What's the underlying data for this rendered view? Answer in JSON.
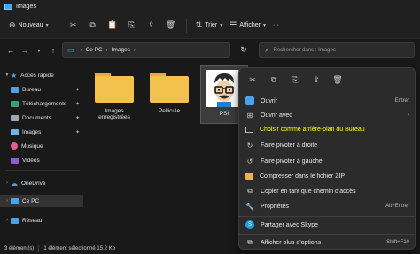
{
  "window": {
    "title": "Images"
  },
  "toolbar": {
    "new_label": "Nouveau",
    "sort_label": "Trier",
    "view_label": "Afficher",
    "more_label": "···"
  },
  "address": {
    "pc_label": "Ce PC",
    "folder_label": "Images",
    "search_placeholder": "Rechercher dans : Images"
  },
  "sidebar": {
    "quick_access": "Accès rapide",
    "items": [
      "Bureau",
      "Téléchargements",
      "Documents",
      "Images",
      "Musique",
      "Vidéos"
    ],
    "onedrive": "OneDrive",
    "this_pc": "Ce PC",
    "network": "Réseau"
  },
  "files": [
    {
      "name": "Images enregistrées"
    },
    {
      "name": "Pellicule"
    },
    {
      "name": "PSI"
    }
  ],
  "status": {
    "count": "3 élément(s)",
    "selected": "1 élément sélectionné 15,2 Ko"
  },
  "context_menu": {
    "items": [
      {
        "label": "Ouvrir",
        "shortcut": "Entrer",
        "icon": "photos-icon"
      },
      {
        "label": "Ouvrir avec",
        "shortcut": "›",
        "icon": "open-with-icon"
      },
      {
        "label": "Choisir comme arrière-plan du Bureau",
        "shortcut": "",
        "icon": "desktop-background-icon"
      },
      {
        "label": "Faire pivoter à droite",
        "shortcut": "",
        "icon": "rotate-right-icon"
      },
      {
        "label": "Faire pivoter à gauche",
        "shortcut": "",
        "icon": "rotate-left-icon"
      },
      {
        "label": "Compresser dans le fichier ZIP",
        "shortcut": "",
        "icon": "zip-icon"
      },
      {
        "label": "Copier en tant que chemin d'accès",
        "shortcut": "",
        "icon": "copy-path-icon"
      },
      {
        "label": "Propriétés",
        "shortcut": "Alt+Entrer",
        "icon": "properties-icon"
      },
      {
        "label": "Partager avec Skype",
        "shortcut": "",
        "icon": "skype-icon"
      },
      {
        "label": "Afficher plus d'options",
        "shortcut": "Shift+F10",
        "icon": "more-options-icon"
      }
    ]
  },
  "colors": {
    "accent": "#4aa3e8",
    "folder": "#f2c14e",
    "highlight_text": "#ffff00"
  }
}
